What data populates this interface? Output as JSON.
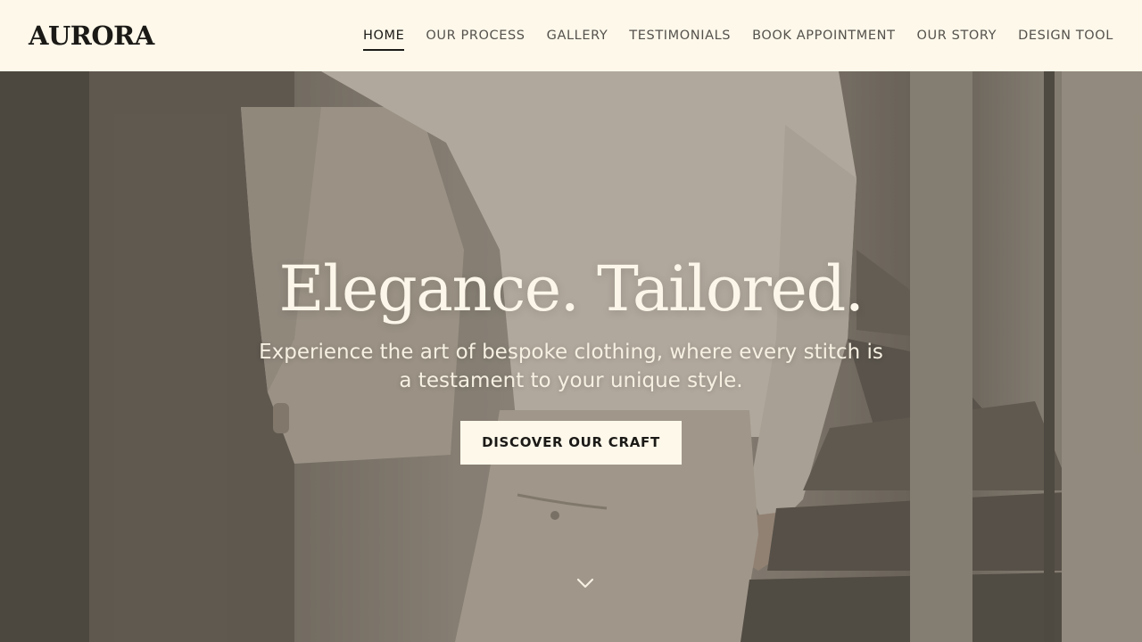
{
  "brand": {
    "logo": "AURORA"
  },
  "nav": {
    "items": [
      {
        "label": "HOME",
        "active": true
      },
      {
        "label": "OUR PROCESS",
        "active": false
      },
      {
        "label": "GALLERY",
        "active": false
      },
      {
        "label": "TESTIMONIALS",
        "active": false
      },
      {
        "label": "BOOK APPOINTMENT",
        "active": false
      },
      {
        "label": "OUR STORY",
        "active": false
      },
      {
        "label": "DESIGN TOOL",
        "active": false
      }
    ]
  },
  "hero": {
    "title": "Elegance. Tailored.",
    "subtitle": "Experience the art of bespoke clothing, where every stitch is a testament to your unique style.",
    "cta_label": "DISCOVER OUR CRAFT",
    "background_description_icon": "tailor-photo",
    "scroll_icon": "chevron-down-icon"
  },
  "colors": {
    "header_bg": "#fdf8ea",
    "text_dark": "#1c1a17",
    "hero_text": "#fbf6e9",
    "button_bg": "#fdf8ea"
  }
}
